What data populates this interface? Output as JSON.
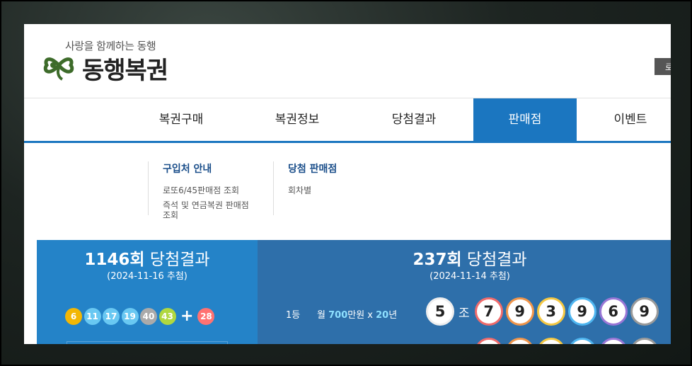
{
  "header": {
    "tagline": "사랑을 함께하는 동행",
    "logo_name": "동행복권",
    "login_label": "로"
  },
  "gnb": {
    "items": [
      {
        "label": "복권구매"
      },
      {
        "label": "복권정보"
      },
      {
        "label": "당첨결과"
      },
      {
        "label": "판매점"
      },
      {
        "label": "이벤트"
      }
    ],
    "active_index": 3
  },
  "dropdown": {
    "col1": {
      "heading": "구입처 안내",
      "links": [
        "로또6/45판매점 조회",
        "즉석 및 연금복권 판매점",
        "조회"
      ]
    },
    "col2": {
      "heading": "당첨 판매점",
      "links": [
        "회차별"
      ]
    }
  },
  "lotto": {
    "round": "1146회",
    "title_suffix": "당첨결과",
    "date": "(2024-11-16 추첨)",
    "balls": [
      {
        "num": "6",
        "color": "#f2b705"
      },
      {
        "num": "11",
        "color": "#69c8f2"
      },
      {
        "num": "17",
        "color": "#69c8f2"
      },
      {
        "num": "19",
        "color": "#69c8f2"
      },
      {
        "num": "40",
        "color": "#aaaaaa"
      },
      {
        "num": "43",
        "color": "#b0d840"
      },
      {
        "num": "28",
        "color": "#ff7272"
      }
    ],
    "plus": "+"
  },
  "pension": {
    "round": "237회",
    "title_suffix": "당첨결과",
    "date": "(2024-11-14 추첨)",
    "rank": "1등",
    "prize_prefix": "월",
    "prize_amount": "700",
    "prize_unit": "만원 x",
    "prize_years": "20",
    "prize_year_unit": "년",
    "group": "5",
    "group_unit": "조",
    "digits": [
      {
        "num": "7",
        "color": "#f06b6b"
      },
      {
        "num": "9",
        "color": "#f0954a"
      },
      {
        "num": "3",
        "color": "#f5c842"
      },
      {
        "num": "9",
        "color": "#4fb6f0"
      },
      {
        "num": "6",
        "color": "#9a77d6"
      },
      {
        "num": "9",
        "color": "#9a9a9a"
      }
    ],
    "second_row_colors": [
      "#f06b6b",
      "#f0954a",
      "#f5c842",
      "#4fb6f0",
      "#9a77d6",
      "#9a9a9a"
    ]
  }
}
